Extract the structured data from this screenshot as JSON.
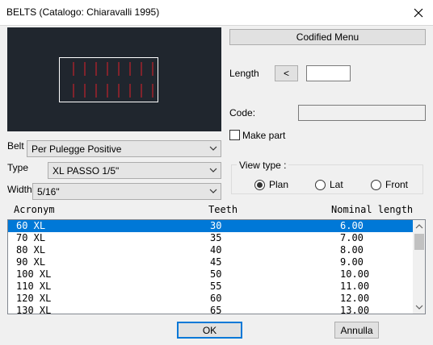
{
  "window": {
    "title": "BELTS (Catalogo: Chiaravalli 1995)"
  },
  "buttons": {
    "codified_menu": "Codified Menu",
    "length_pick": "<",
    "ok": "OK",
    "cancel": "Annulla"
  },
  "fields": {
    "length_label": "Length",
    "length_value": "",
    "code_label": "Code:",
    "code_value": "",
    "make_part_label": "Make part",
    "make_part_checked": false
  },
  "selectors": {
    "belt": {
      "label": "Belt",
      "value": "Per Pulegge Positive"
    },
    "type": {
      "label": "Type",
      "value": "XL PASSO 1/5\""
    },
    "width": {
      "label": "Width",
      "value": "5/16\""
    }
  },
  "view_type": {
    "legend": "View type  :",
    "options": [
      {
        "label": "Plan",
        "selected": true
      },
      {
        "label": "Lat",
        "selected": false
      },
      {
        "label": "Front",
        "selected": false
      }
    ]
  },
  "table": {
    "headers": {
      "acronym": "Acronym",
      "teeth": "Teeth",
      "nominal_length": "Nominal length"
    },
    "rows": [
      {
        "acronym": "60 XL",
        "teeth": "30",
        "nominal_length": "6.00",
        "selected": true
      },
      {
        "acronym": "70 XL",
        "teeth": "35",
        "nominal_length": "7.00",
        "selected": false
      },
      {
        "acronym": "80 XL",
        "teeth": "40",
        "nominal_length": "8.00",
        "selected": false
      },
      {
        "acronym": "90 XL",
        "teeth": "45",
        "nominal_length": "9.00",
        "selected": false
      },
      {
        "acronym": "100 XL",
        "teeth": "50",
        "nominal_length": "10.00",
        "selected": false
      },
      {
        "acronym": "110 XL",
        "teeth": "55",
        "nominal_length": "11.00",
        "selected": false
      },
      {
        "acronym": "120 XL",
        "teeth": "60",
        "nominal_length": "12.00",
        "selected": false
      },
      {
        "acronym": "130 XL",
        "teeth": "65",
        "nominal_length": "13.00",
        "selected": false
      }
    ]
  },
  "colors": {
    "preview_background": "#20262e",
    "preview_outline": "#ffffff",
    "preview_teeth": "#e0202a",
    "selection": "#0078d7"
  }
}
